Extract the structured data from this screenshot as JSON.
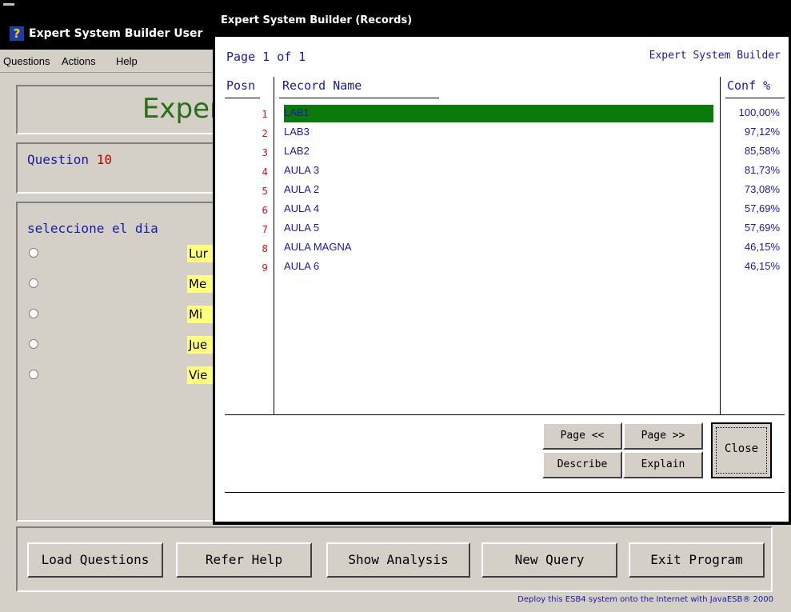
{
  "main_window": {
    "title": "Expert System Builder User",
    "menu": [
      "Questions",
      "Actions",
      "Help"
    ],
    "header_title": "Exper",
    "question_label": "Question",
    "question_number": "10",
    "prompt": "seleccione el dia",
    "options": [
      "Lur",
      "Me",
      "Mi",
      "Jue",
      "Vie"
    ],
    "buttons": {
      "load": "Load Questions",
      "refer": "Refer Help",
      "analysis": "Show Analysis",
      "new_query": "New Query",
      "exit": "Exit Program"
    },
    "deploy_text": "Deploy this ESB4 system onto the Internet with JavaESB® 2000"
  },
  "dialog": {
    "title": "Expert System Builder (Records)",
    "page_label": "Page 1 of 1",
    "brand": "Expert System Builder",
    "columns": {
      "posn": "Posn",
      "name": "Record Name",
      "conf": "Conf %"
    },
    "records": [
      {
        "posn": "1",
        "name": "LAB1",
        "conf": "100,00%"
      },
      {
        "posn": "2",
        "name": "LAB3",
        "conf": "97,12%"
      },
      {
        "posn": "3",
        "name": "LAB2",
        "conf": "85,58%"
      },
      {
        "posn": "4",
        "name": "AULA 3",
        "conf": "81,73%"
      },
      {
        "posn": "5",
        "name": "AULA 2",
        "conf": "73,08%"
      },
      {
        "posn": "6",
        "name": "AULA 4",
        "conf": "57,69%"
      },
      {
        "posn": "7",
        "name": "AULA 5",
        "conf": "57,69%"
      },
      {
        "posn": "8",
        "name": "AULA MAGNA",
        "conf": "46,15%"
      },
      {
        "posn": "9",
        "name": "AULA 6",
        "conf": "46,15%"
      }
    ],
    "buttons": {
      "page_prev": "Page <<",
      "page_next": "Page >>",
      "describe": "Describe",
      "explain": "Explain",
      "close": "Close"
    }
  },
  "colors": {
    "highlight_bar": "#0a7a0a",
    "text_blue": "#1a1aa0",
    "posn_red": "#e01010",
    "option_yellow": "#ffff80"
  }
}
